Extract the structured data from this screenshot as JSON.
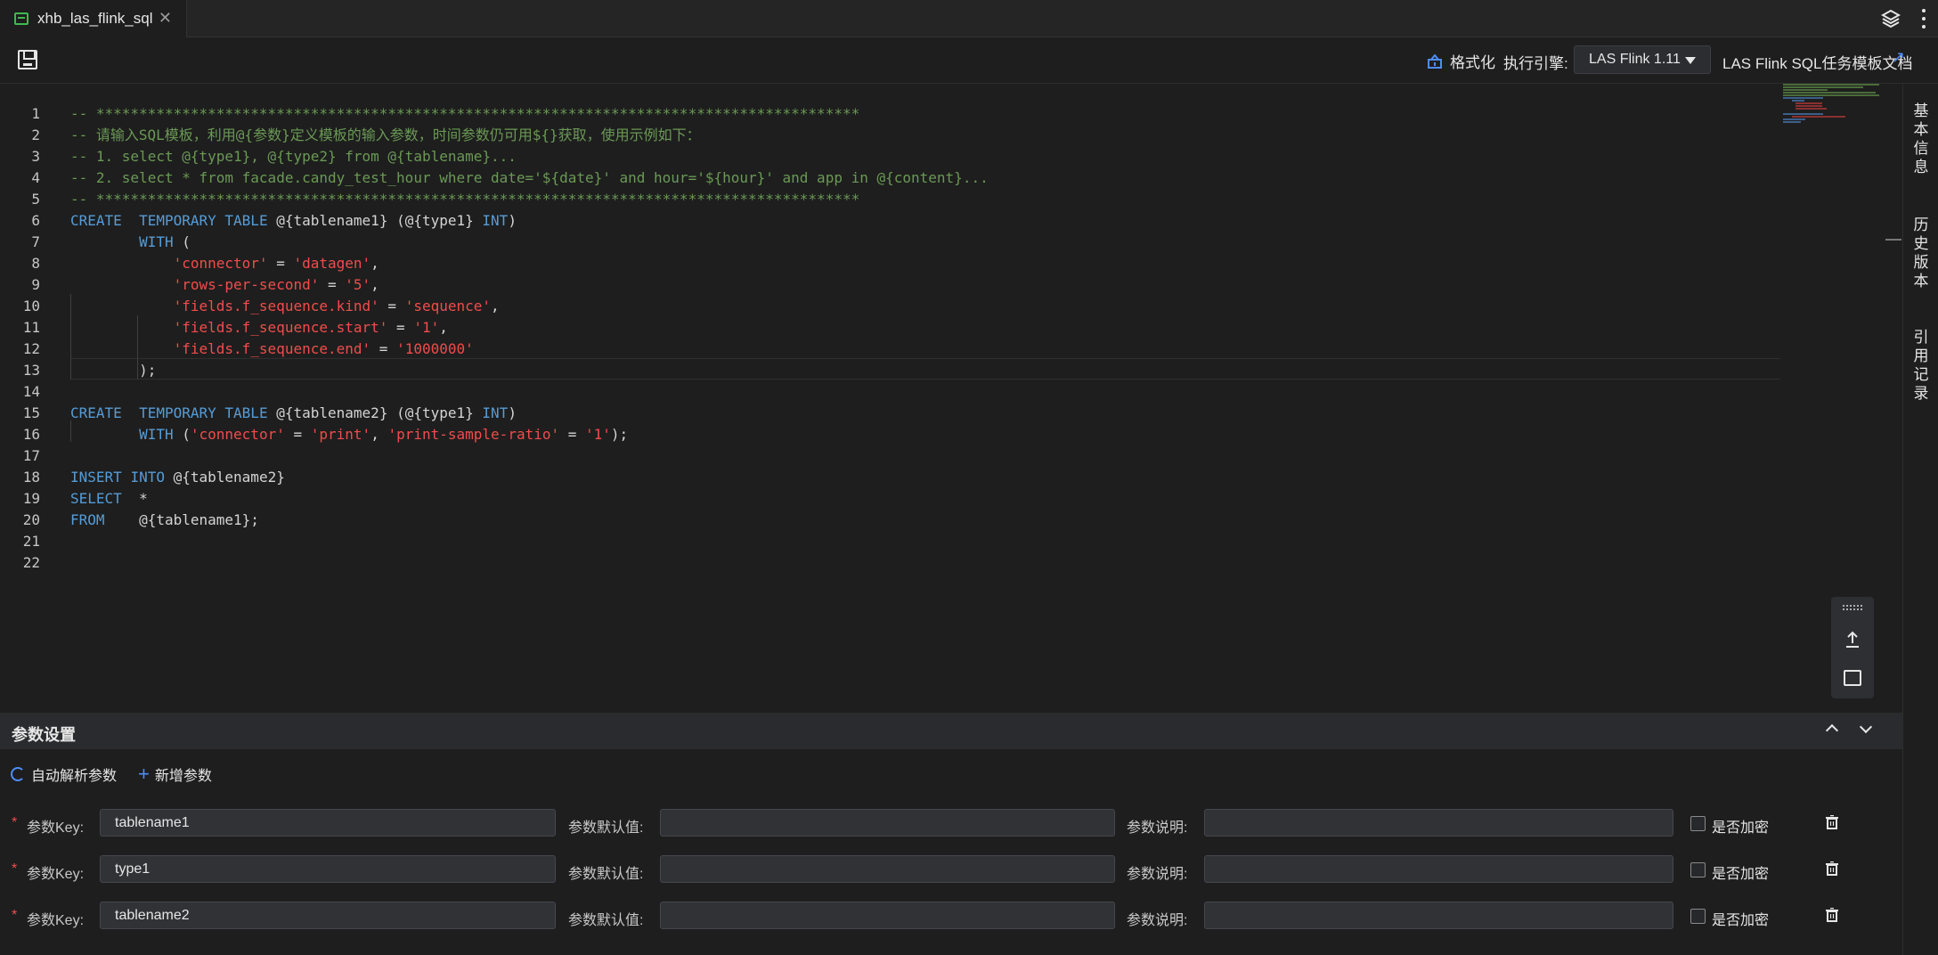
{
  "tab": {
    "title": "xhb_las_flink_sql",
    "icons": [
      "sql-file-icon",
      "close-icon",
      "layers-icon",
      "more-icon"
    ]
  },
  "toolbar": {
    "format_label": "格式化",
    "engine_label": "执行引擎:",
    "engine_value": "LAS Flink 1.11",
    "docs_label": "LAS Flink SQL任务模板文档",
    "docs_arrow": "↗",
    "accent": "#4d8df7"
  },
  "editor": {
    "line_numbers": [
      "1",
      "2",
      "3",
      "4",
      "5",
      "6",
      "7",
      "8",
      "9",
      "10",
      "11",
      "12",
      "13",
      "14",
      "15",
      "16",
      "17",
      "18",
      "19",
      "20",
      "21",
      "22"
    ]
  },
  "sidebar": {
    "tabs": [
      "基本信息",
      "历史版本",
      "引用记录"
    ]
  },
  "params": {
    "title": "参数设置",
    "auto_parse_label": "自动解析参数",
    "add_label": "新增参数",
    "key_label": "参数Key:",
    "default_label": "参数默认值:",
    "desc_label": "参数说明:",
    "encrypt_label": "是否加密",
    "rows": [
      {
        "key": "tablename1",
        "default": "",
        "desc": "",
        "encrypted": false
      },
      {
        "key": "type1",
        "default": "",
        "desc": "",
        "encrypted": false
      },
      {
        "key": "tablename2",
        "default": "",
        "desc": "",
        "encrypted": false
      }
    ]
  },
  "colors": {
    "keyword": "#569cd6",
    "string": "#f14c4c",
    "comment": "#6a9955",
    "background": "#1e1e1e"
  }
}
